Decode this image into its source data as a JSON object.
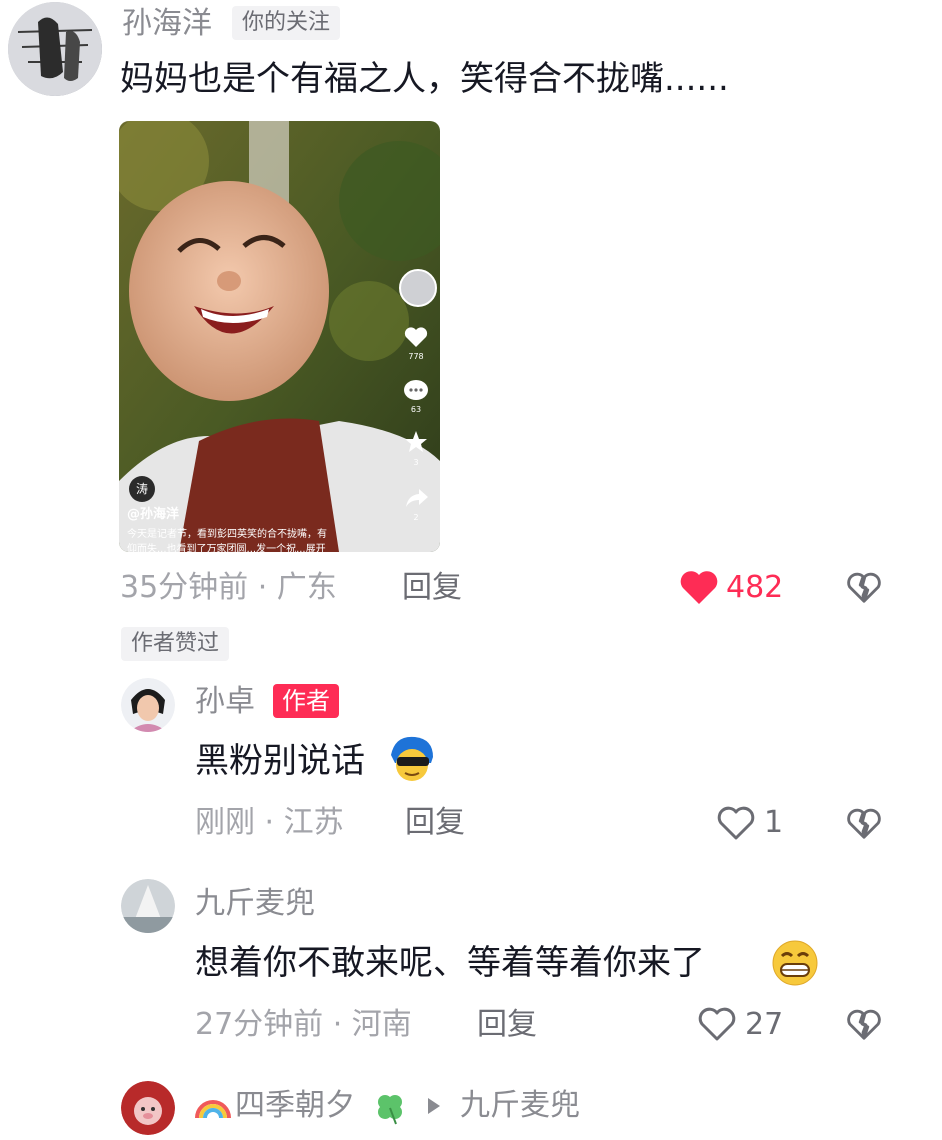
{
  "comment1": {
    "author": "孙海洋",
    "follow_tag": "你的关注",
    "text": "妈妈也是个有福之人，笑得合不拢嘴......",
    "time_location": "35分钟前 · 广东",
    "reply_label": "回复",
    "like_count": "482",
    "liked": true,
    "author_liked_tag": "作者赞过",
    "video": {
      "rail_like_count": "778",
      "rail_comment_count": "63",
      "rail_fav_count": "3",
      "rail_share_count": "2",
      "overlay_author": "@孙海洋",
      "overlay_caption_line1": "今天是记者节，看到彭四英笑的合不拢嘴，有",
      "overlay_caption_line2": "仰而失...也看到了万家团圆...发一个祝...展开",
      "overlay_badge": "涛"
    }
  },
  "reply1": {
    "author": "孙卓",
    "author_tag": "作者",
    "text": "黑粉别说话",
    "time_location": "刚刚 · 江苏",
    "reply_label": "回复",
    "like_count": "1"
  },
  "reply2": {
    "author": "九斤麦兜",
    "text": "想着你不敢来呢、等着等着你来了",
    "time_location": "27分钟前 · 河南",
    "reply_label": "回复",
    "like_count": "27"
  },
  "reply3": {
    "author": "四季朝夕",
    "reply_to": "九斤麦兜"
  },
  "colors": {
    "accent_red": "#fe2c55",
    "meta_gray": "#a3a4aa",
    "name_gray": "#8a8b91"
  },
  "icons": [
    "heart-filled-icon",
    "heart-outline-icon",
    "dislike-heart-icon",
    "arrow-right-icon",
    "rainbow-emoji",
    "clover-emoji",
    "cool-emoji",
    "grin-emoji"
  ]
}
